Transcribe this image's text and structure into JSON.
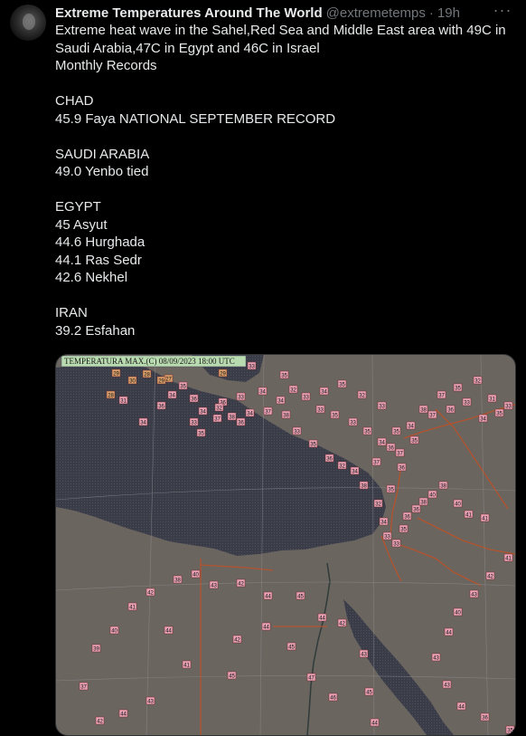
{
  "author": {
    "name": "Extreme Temperatures Around The World",
    "handle": "@extremetemps",
    "separator": "·",
    "time": "19h"
  },
  "more_icon": "more-horizontal-icon",
  "body": {
    "intro_line1": "Extreme heat wave in the Sahel,Red Sea and Middle East area with 49C in",
    "intro_line2": "Saudi Arabia,47C in Egypt and 46C in Israel",
    "intro_line3": "Monthly Records",
    "chad_title": "CHAD",
    "chad_1": "45.9 Faya NATIONAL SEPTEMBER RECORD",
    "saudi_title": "SAUDI ARABIA",
    "saudi_1": "49.0 Yenbo tied",
    "egypt_title": "EGYPT",
    "egypt_1": "45 Asyut",
    "egypt_2": "44.6 Hurghada",
    "egypt_3": "44.1 Ras Sedr",
    "egypt_4": "42.6 Nekhel",
    "iran_title": "IRAN",
    "iran_1": "39.2 Esfahan"
  },
  "map": {
    "title": "TEMPERATURA MAX.(C)    08/09/2023 18:00 UTC",
    "colors": {
      "land": "#6b6560",
      "sea": "#3b3d4a",
      "marker_red": "#e9a3b6",
      "marker_orange": "#d9a06b",
      "border": "#b3532d"
    },
    "markers": [
      {
        "v": "29",
        "c": "o"
      },
      {
        "v": "28",
        "c": "o"
      },
      {
        "v": "27",
        "c": "o"
      },
      {
        "v": "29",
        "c": "o"
      },
      {
        "v": "33",
        "c": "r"
      },
      {
        "v": "35",
        "c": "r"
      },
      {
        "v": "34",
        "c": "r"
      },
      {
        "v": "34",
        "c": "r"
      },
      {
        "v": "33",
        "c": "r"
      },
      {
        "v": "36",
        "c": "r"
      },
      {
        "v": "38",
        "c": "r"
      },
      {
        "v": "32",
        "c": "r"
      },
      {
        "v": "34",
        "c": "r"
      },
      {
        "v": "35",
        "c": "r"
      },
      {
        "v": "36",
        "c": "r"
      },
      {
        "v": "34",
        "c": "r"
      },
      {
        "v": "29",
        "c": "o"
      },
      {
        "v": "30",
        "c": "o"
      },
      {
        "v": "28",
        "c": "o"
      },
      {
        "v": "31",
        "c": "r"
      },
      {
        "v": "34",
        "c": "r"
      },
      {
        "v": "36",
        "c": "r"
      },
      {
        "v": "33",
        "c": "r"
      },
      {
        "v": "35",
        "c": "r"
      },
      {
        "v": "37",
        "c": "r"
      },
      {
        "v": "36",
        "c": "r"
      },
      {
        "v": "34",
        "c": "r"
      },
      {
        "v": "37",
        "c": "r"
      },
      {
        "v": "38",
        "c": "r"
      },
      {
        "v": "33",
        "c": "r"
      },
      {
        "v": "35",
        "c": "r"
      },
      {
        "v": "36",
        "c": "r"
      },
      {
        "v": "32",
        "c": "r"
      },
      {
        "v": "34",
        "c": "r"
      },
      {
        "v": "38",
        "c": "r"
      },
      {
        "v": "37",
        "c": "r"
      },
      {
        "v": "36",
        "c": "r"
      },
      {
        "v": "35",
        "c": "r"
      },
      {
        "v": "34",
        "c": "r"
      },
      {
        "v": "38",
        "c": "r"
      },
      {
        "v": "37",
        "c": "r"
      },
      {
        "v": "35",
        "c": "r"
      },
      {
        "v": "32",
        "c": "r"
      },
      {
        "v": "31",
        "c": "r"
      },
      {
        "v": "33",
        "c": "r"
      },
      {
        "v": "34",
        "c": "r"
      },
      {
        "v": "35",
        "c": "r"
      },
      {
        "v": "33",
        "c": "r"
      },
      {
        "v": "36",
        "c": "r"
      },
      {
        "v": "37",
        "c": "r"
      },
      {
        "v": "35",
        "c": "r"
      },
      {
        "v": "37",
        "c": "r"
      },
      {
        "v": "34",
        "c": "r"
      },
      {
        "v": "35",
        "c": "r"
      },
      {
        "v": "33",
        "c": "r"
      },
      {
        "v": "35",
        "c": "r"
      },
      {
        "v": "33",
        "c": "r"
      },
      {
        "v": "33",
        "c": "r"
      },
      {
        "v": "32",
        "c": "r"
      },
      {
        "v": "34",
        "c": "r"
      },
      {
        "v": "35",
        "c": "r"
      },
      {
        "v": "32",
        "c": "r"
      },
      {
        "v": "33",
        "c": "r"
      },
      {
        "v": "36",
        "c": "r"
      },
      {
        "v": "35",
        "c": "r"
      },
      {
        "v": "32",
        "c": "r"
      },
      {
        "v": "34",
        "c": "r"
      },
      {
        "v": "33",
        "c": "r"
      },
      {
        "v": "33",
        "c": "r"
      },
      {
        "v": "35",
        "c": "r"
      },
      {
        "v": "36",
        "c": "r"
      },
      {
        "v": "36",
        "c": "r"
      },
      {
        "v": "38",
        "c": "r"
      },
      {
        "v": "40",
        "c": "r"
      },
      {
        "v": "38",
        "c": "r"
      },
      {
        "v": "40",
        "c": "r"
      },
      {
        "v": "41",
        "c": "r"
      },
      {
        "v": "41",
        "c": "r"
      },
      {
        "v": "41",
        "c": "r"
      },
      {
        "v": "42",
        "c": "r"
      },
      {
        "v": "43",
        "c": "r"
      },
      {
        "v": "40",
        "c": "r"
      },
      {
        "v": "44",
        "c": "r"
      },
      {
        "v": "43",
        "c": "r"
      },
      {
        "v": "43",
        "c": "r"
      },
      {
        "v": "44",
        "c": "r"
      },
      {
        "v": "36",
        "c": "r"
      },
      {
        "v": "35",
        "c": "r"
      },
      {
        "v": "37",
        "c": "r"
      },
      {
        "v": "39",
        "c": "r"
      },
      {
        "v": "40",
        "c": "r"
      },
      {
        "v": "41",
        "c": "r"
      },
      {
        "v": "42",
        "c": "r"
      },
      {
        "v": "38",
        "c": "r"
      },
      {
        "v": "40",
        "c": "r"
      },
      {
        "v": "43",
        "c": "r"
      },
      {
        "v": "42",
        "c": "r"
      },
      {
        "v": "44",
        "c": "r"
      },
      {
        "v": "45",
        "c": "r"
      },
      {
        "v": "44",
        "c": "r"
      },
      {
        "v": "42",
        "c": "r"
      },
      {
        "v": "43",
        "c": "r"
      },
      {
        "v": "45",
        "c": "r"
      },
      {
        "v": "44",
        "c": "r"
      },
      {
        "v": "46",
        "c": "r"
      },
      {
        "v": "47",
        "c": "r"
      },
      {
        "v": "45",
        "c": "r"
      },
      {
        "v": "44",
        "c": "r"
      },
      {
        "v": "42",
        "c": "r"
      },
      {
        "v": "41",
        "c": "r"
      },
      {
        "v": "43",
        "c": "r"
      },
      {
        "v": "44",
        "c": "r"
      },
      {
        "v": "42",
        "c": "r"
      },
      {
        "v": "44",
        "c": "r"
      },
      {
        "v": "45",
        "c": "r"
      }
    ]
  }
}
